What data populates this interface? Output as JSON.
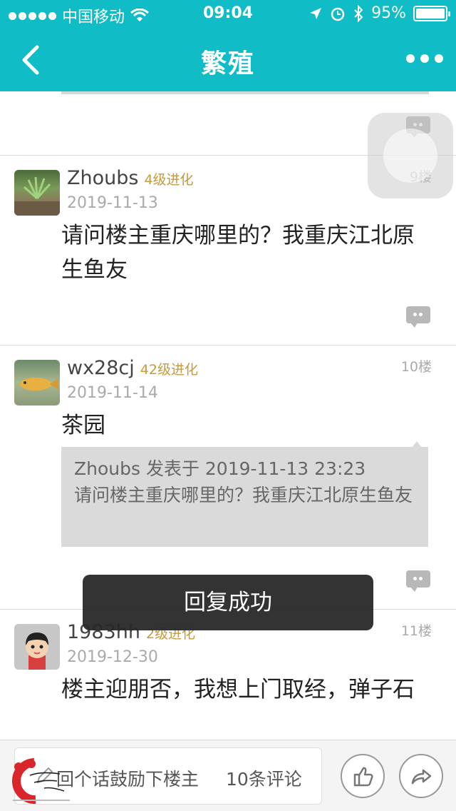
{
  "status_bar": {
    "carrier": "中国移动",
    "time": "09:04",
    "battery": "95%"
  },
  "nav": {
    "title": "繁殖"
  },
  "posts": [
    {
      "username": "Zhoubs",
      "level": "4级进化",
      "date": "2019-11-13",
      "floor": "9楼",
      "content": "请问楼主重庆哪里的？我重庆江北原生鱼友"
    },
    {
      "username": "wx28cj",
      "level": "42级进化",
      "date": "2019-11-14",
      "floor": "10楼",
      "content": "茶园",
      "quote_header": "Zhoubs 发表于 2019-11-13 23:23",
      "quote_text": "请问楼主重庆哪里的？我重庆江北原生鱼友"
    },
    {
      "username": "1983hh",
      "level": "2级进化",
      "date": "2019-12-30",
      "floor": "11楼",
      "content": "楼主迎朋否，我想上门取经，弹子石"
    }
  ],
  "toast": {
    "message": "回复成功"
  },
  "bottom_bar": {
    "reply_placeholder": "回个话鼓励下楼主",
    "comment_count": "10条评论"
  },
  "colors": {
    "header": "#10bcc6",
    "level": "#c79a3c"
  }
}
